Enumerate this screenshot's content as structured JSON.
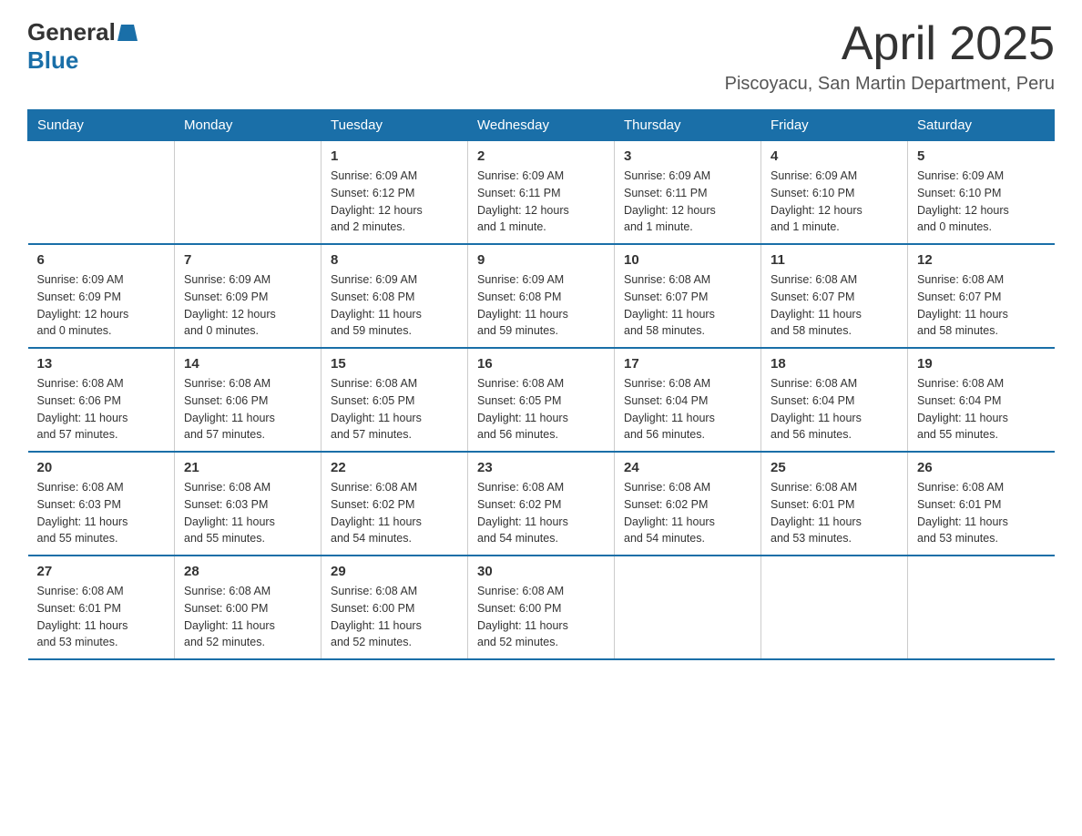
{
  "logo": {
    "general": "General",
    "blue": "Blue"
  },
  "title": "April 2025",
  "location": "Piscoyacu, San Martin Department, Peru",
  "days_of_week": [
    "Sunday",
    "Monday",
    "Tuesday",
    "Wednesday",
    "Thursday",
    "Friday",
    "Saturday"
  ],
  "weeks": [
    [
      {
        "day": "",
        "info": ""
      },
      {
        "day": "",
        "info": ""
      },
      {
        "day": "1",
        "info": "Sunrise: 6:09 AM\nSunset: 6:12 PM\nDaylight: 12 hours\nand 2 minutes."
      },
      {
        "day": "2",
        "info": "Sunrise: 6:09 AM\nSunset: 6:11 PM\nDaylight: 12 hours\nand 1 minute."
      },
      {
        "day": "3",
        "info": "Sunrise: 6:09 AM\nSunset: 6:11 PM\nDaylight: 12 hours\nand 1 minute."
      },
      {
        "day": "4",
        "info": "Sunrise: 6:09 AM\nSunset: 6:10 PM\nDaylight: 12 hours\nand 1 minute."
      },
      {
        "day": "5",
        "info": "Sunrise: 6:09 AM\nSunset: 6:10 PM\nDaylight: 12 hours\nand 0 minutes."
      }
    ],
    [
      {
        "day": "6",
        "info": "Sunrise: 6:09 AM\nSunset: 6:09 PM\nDaylight: 12 hours\nand 0 minutes."
      },
      {
        "day": "7",
        "info": "Sunrise: 6:09 AM\nSunset: 6:09 PM\nDaylight: 12 hours\nand 0 minutes."
      },
      {
        "day": "8",
        "info": "Sunrise: 6:09 AM\nSunset: 6:08 PM\nDaylight: 11 hours\nand 59 minutes."
      },
      {
        "day": "9",
        "info": "Sunrise: 6:09 AM\nSunset: 6:08 PM\nDaylight: 11 hours\nand 59 minutes."
      },
      {
        "day": "10",
        "info": "Sunrise: 6:08 AM\nSunset: 6:07 PM\nDaylight: 11 hours\nand 58 minutes."
      },
      {
        "day": "11",
        "info": "Sunrise: 6:08 AM\nSunset: 6:07 PM\nDaylight: 11 hours\nand 58 minutes."
      },
      {
        "day": "12",
        "info": "Sunrise: 6:08 AM\nSunset: 6:07 PM\nDaylight: 11 hours\nand 58 minutes."
      }
    ],
    [
      {
        "day": "13",
        "info": "Sunrise: 6:08 AM\nSunset: 6:06 PM\nDaylight: 11 hours\nand 57 minutes."
      },
      {
        "day": "14",
        "info": "Sunrise: 6:08 AM\nSunset: 6:06 PM\nDaylight: 11 hours\nand 57 minutes."
      },
      {
        "day": "15",
        "info": "Sunrise: 6:08 AM\nSunset: 6:05 PM\nDaylight: 11 hours\nand 57 minutes."
      },
      {
        "day": "16",
        "info": "Sunrise: 6:08 AM\nSunset: 6:05 PM\nDaylight: 11 hours\nand 56 minutes."
      },
      {
        "day": "17",
        "info": "Sunrise: 6:08 AM\nSunset: 6:04 PM\nDaylight: 11 hours\nand 56 minutes."
      },
      {
        "day": "18",
        "info": "Sunrise: 6:08 AM\nSunset: 6:04 PM\nDaylight: 11 hours\nand 56 minutes."
      },
      {
        "day": "19",
        "info": "Sunrise: 6:08 AM\nSunset: 6:04 PM\nDaylight: 11 hours\nand 55 minutes."
      }
    ],
    [
      {
        "day": "20",
        "info": "Sunrise: 6:08 AM\nSunset: 6:03 PM\nDaylight: 11 hours\nand 55 minutes."
      },
      {
        "day": "21",
        "info": "Sunrise: 6:08 AM\nSunset: 6:03 PM\nDaylight: 11 hours\nand 55 minutes."
      },
      {
        "day": "22",
        "info": "Sunrise: 6:08 AM\nSunset: 6:02 PM\nDaylight: 11 hours\nand 54 minutes."
      },
      {
        "day": "23",
        "info": "Sunrise: 6:08 AM\nSunset: 6:02 PM\nDaylight: 11 hours\nand 54 minutes."
      },
      {
        "day": "24",
        "info": "Sunrise: 6:08 AM\nSunset: 6:02 PM\nDaylight: 11 hours\nand 54 minutes."
      },
      {
        "day": "25",
        "info": "Sunrise: 6:08 AM\nSunset: 6:01 PM\nDaylight: 11 hours\nand 53 minutes."
      },
      {
        "day": "26",
        "info": "Sunrise: 6:08 AM\nSunset: 6:01 PM\nDaylight: 11 hours\nand 53 minutes."
      }
    ],
    [
      {
        "day": "27",
        "info": "Sunrise: 6:08 AM\nSunset: 6:01 PM\nDaylight: 11 hours\nand 53 minutes."
      },
      {
        "day": "28",
        "info": "Sunrise: 6:08 AM\nSunset: 6:00 PM\nDaylight: 11 hours\nand 52 minutes."
      },
      {
        "day": "29",
        "info": "Sunrise: 6:08 AM\nSunset: 6:00 PM\nDaylight: 11 hours\nand 52 minutes."
      },
      {
        "day": "30",
        "info": "Sunrise: 6:08 AM\nSunset: 6:00 PM\nDaylight: 11 hours\nand 52 minutes."
      },
      {
        "day": "",
        "info": ""
      },
      {
        "day": "",
        "info": ""
      },
      {
        "day": "",
        "info": ""
      }
    ]
  ]
}
